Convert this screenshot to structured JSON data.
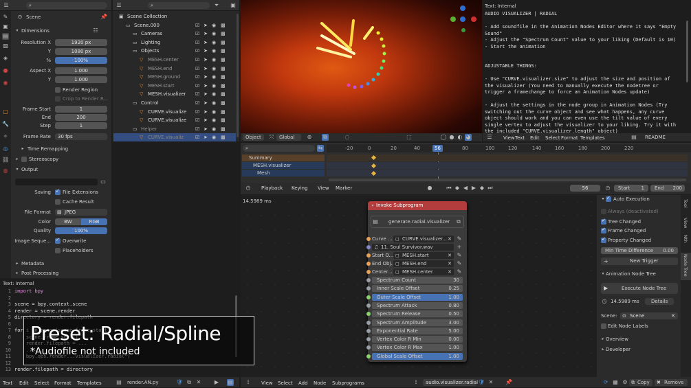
{
  "props": {
    "search_placeholder": "",
    "scene_name": "Scene",
    "dimensions": "Dimensions",
    "res_x_label": "Resolution X",
    "res_x": "1920 px",
    "res_y_label": "Y",
    "res_y": "1080 px",
    "res_pct_label": "%",
    "res_pct": "100%",
    "aspect_x_label": "Aspect X",
    "aspect_x": "1.000",
    "aspect_y_label": "Y",
    "aspect_y": "1.000",
    "render_region": "Render Region",
    "crop": "Crop to Render R...",
    "frame_start_label": "Frame Start",
    "frame_start": "1",
    "end_label": "End",
    "end": "200",
    "step_label": "Step",
    "step": "1",
    "frame_rate_label": "Frame Rate",
    "frame_rate": "30 fps",
    "time_remap": "Time Remapping",
    "stereo": "Stereoscopy",
    "output": "Output",
    "saving_label": "Saving",
    "file_ext": "File Extensions",
    "cache_result": "Cache Result",
    "file_format_label": "File Format",
    "file_format": "JPEG",
    "color_label": "Color",
    "bw": "BW",
    "rgb": "RGB",
    "quality_label": "Quality",
    "quality": "100%",
    "image_seq_label": "Image Seque...",
    "overwrite": "Overwrite",
    "placeholders": "Placeholders",
    "metadata": "Metadata",
    "post_processing": "Post Processing"
  },
  "outliner": {
    "rows": [
      {
        "label": "Scene Collection",
        "indent": 0
      },
      {
        "label": "Scene.000",
        "indent": 1
      },
      {
        "label": "Cameras",
        "indent": 2
      },
      {
        "label": "Lighting",
        "indent": 2
      },
      {
        "label": "Objects",
        "indent": 2
      },
      {
        "label": "MESH.center",
        "indent": 3
      },
      {
        "label": "MESH.end",
        "indent": 3
      },
      {
        "label": "MESH.ground",
        "indent": 3
      },
      {
        "label": "MESH.start",
        "indent": 3
      },
      {
        "label": "MESH.visualizer",
        "indent": 3
      },
      {
        "label": "Control",
        "indent": 2
      },
      {
        "label": "CURVE.visualize",
        "indent": 3
      },
      {
        "label": "CURVE.visualize",
        "indent": 3
      },
      {
        "label": "Helper",
        "indent": 2
      },
      {
        "label": "CURVE.visualiz",
        "indent": 3
      }
    ]
  },
  "viewport": {
    "mode": "Object",
    "orientation": "Global"
  },
  "text_top": {
    "header": "Text: Internal",
    "lines": [
      "AUDIO VISUALIZER | RADIAL",
      "",
      "- Add soundfile in the Animation Nodes Editor where it says \"Empty",
      "Sound\"",
      "- Adjust the \"Spectrum Count\" value to your liking (Default is 10)",
      "- Start the animation",
      "",
      "",
      "ADJUSTABLE THINGS:",
      "",
      "- Use \"CURVE.visualizer.size\" to adjust the size and position of",
      "the visualizer (You need to manually execute the nodetree or",
      "trigger a framechange to force an Animation Nodes update)",
      "",
      "- Adjust the settings in the node group in Animation Nodes (Try",
      "switching out the curve object and see what happens, any curve",
      "object should work and you can even use the tilt value of every",
      "single vertex to adjust the visualizer to your liking. Try it with",
      "the included \"CURVE.visualizer.length\" object)"
    ],
    "menu": [
      "View",
      "Text",
      "Edit",
      "Select",
      "Format",
      "Templates"
    ],
    "file": "README"
  },
  "timeline": {
    "ticks": [
      "-20",
      "0",
      "20",
      "40",
      "56",
      "80",
      "100",
      "120",
      "140",
      "160",
      "180",
      "200",
      "220"
    ],
    "channels": [
      "Summary",
      "MESH.visualizer",
      "Mesh"
    ],
    "menu": [
      "Playback",
      "Keying",
      "View",
      "Marker"
    ],
    "current": "56",
    "start_label": "Start",
    "start": "1",
    "end_label": "End",
    "end": "200"
  },
  "node_editor": {
    "time": "14.5989 ms",
    "node_title": "Invoke Subprogram",
    "program": "generate.radial.visualizer",
    "rows": [
      {
        "label": "Curve ...",
        "value": "CURVE.visualizer..."
      },
      {
        "label": "",
        "value": "11. Soul Survivor.wav"
      },
      {
        "label": "Start O...",
        "value": "MESH.start"
      },
      {
        "label": "End Obj...",
        "value": "MESH.end"
      },
      {
        "label": "Center...",
        "value": "MESH.center"
      }
    ],
    "values": [
      {
        "label": "Spectrum Count",
        "value": "30",
        "hl": false
      },
      {
        "label": "Inner Scale Offset",
        "value": "0.25",
        "hl": false
      },
      {
        "label": "Outer Scale Offset",
        "value": "1.00",
        "hl": true
      },
      {
        "label": "Spectrum Attack",
        "value": "0.80",
        "hl": false
      },
      {
        "label": "Spectrum Release",
        "value": "0.50",
        "hl": false
      },
      {
        "label": "Spectrum Amplitude",
        "value": "3.00",
        "hl": false
      },
      {
        "label": "Exponential Rate",
        "value": "5.00",
        "hl": false
      },
      {
        "label": "Vertex Color R Min",
        "value": "0.00",
        "hl": false
      },
      {
        "label": "Vertex Color R Max",
        "value": "1.00",
        "hl": false
      },
      {
        "label": "Global Scale Offset",
        "value": "1.00",
        "hl": true
      }
    ],
    "menu": [
      "View",
      "Select",
      "Add",
      "Node",
      "Subprograms"
    ],
    "tree_name": "audio.visualizer.radial"
  },
  "sidebar": {
    "auto_exec": "Auto Execution",
    "always": "Always (deactivated)",
    "tree_changed": "Tree Changed",
    "frame_changed": "Frame Changed",
    "prop_changed": "Property Changed",
    "min_time_label": "Min Time Difference",
    "min_time": "0.00",
    "new_trigger": "New Trigger",
    "anim_tree": "Animation Node Tree",
    "execute": "Execute Node Tree",
    "exec_time": "14.5989 ms",
    "details": "Details",
    "scene_label": "Scene:",
    "scene": "Scene",
    "edit_labels": "Edit Node Labels",
    "overview": "Overview",
    "developer": "Developer",
    "tabs": [
      "Tool",
      "View",
      "Nth",
      "Node Tree"
    ],
    "copy": "Copy",
    "remove": "Remove"
  },
  "script": {
    "header": "Text: Internal",
    "line_numbers": [
      "1",
      "2",
      "3",
      "4",
      "5",
      "6",
      "7",
      "8",
      "9",
      "10",
      "11",
      "12",
      "13"
    ],
    "lines": [
      "import bpy",
      "",
      "scene = bpy.context.scene",
      "render = scene.render",
      "directory = render.filepath",
      "",
      "for i in range(scene.frame_start,",
      "    scene.frame_set(i)",
      "    render.filepath = ...",
      "    ...",
      "    bpy.ops.render...visualizer.radial\")",
      "",
      "render.filepath = directory"
    ],
    "menu": [
      "Text",
      "Edit",
      "Select",
      "Format",
      "Templates"
    ],
    "file": "render.AN.py"
  },
  "overlay": {
    "title": "Preset: Radial/Spline",
    "subtitle": "*Audiofile not included"
  }
}
